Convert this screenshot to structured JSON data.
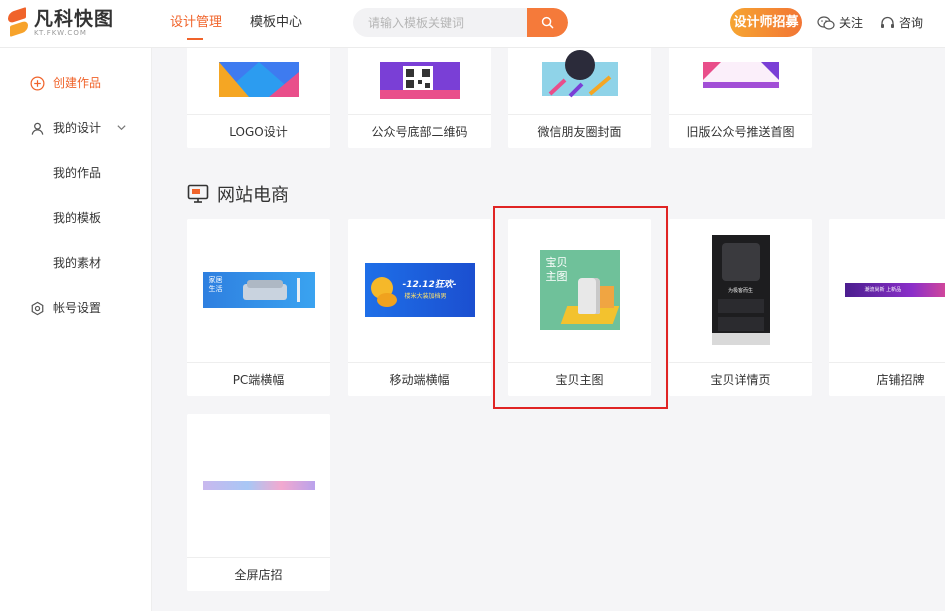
{
  "brand": {
    "name": "凡科快图",
    "sub": "KT.FKW.COM"
  },
  "nav": {
    "items": [
      "设计管理",
      "模板中心"
    ]
  },
  "search": {
    "placeholder": "请输入模板关键词"
  },
  "header": {
    "recruit": "设计师招募",
    "follow": "关注",
    "consult": "咨询"
  },
  "sidebar": {
    "create": "创建作品",
    "my_design": "我的设计",
    "my_works": "我的作品",
    "my_templates": "我的模板",
    "my_materials": "我的素材",
    "account": "帐号设置"
  },
  "top_row": [
    {
      "label": "LOGO设计"
    },
    {
      "label": "公众号底部二维码"
    },
    {
      "label": "微信朋友圈封面"
    },
    {
      "label": "旧版公众号推送首图"
    }
  ],
  "section": {
    "title": "网站电商"
  },
  "ecommerce": [
    {
      "label": "PC端横幅",
      "thumb_text": "家居\n生活"
    },
    {
      "label": "移动端横幅",
      "thumb_text": "-12.12狂欢-",
      "thumb_sub": "楼米大装加档男"
    },
    {
      "label": "宝贝主图",
      "thumb_text": "宝贝主图"
    },
    {
      "label": "宝贝详情页",
      "thumb_text": "为极客而生"
    },
    {
      "label": "店铺招牌",
      "thumb_text": "潮流尚新 上新品"
    },
    {
      "label": "全屏店招"
    }
  ],
  "colors": {
    "accent": "#f0632a",
    "highlight": "#e02424"
  }
}
